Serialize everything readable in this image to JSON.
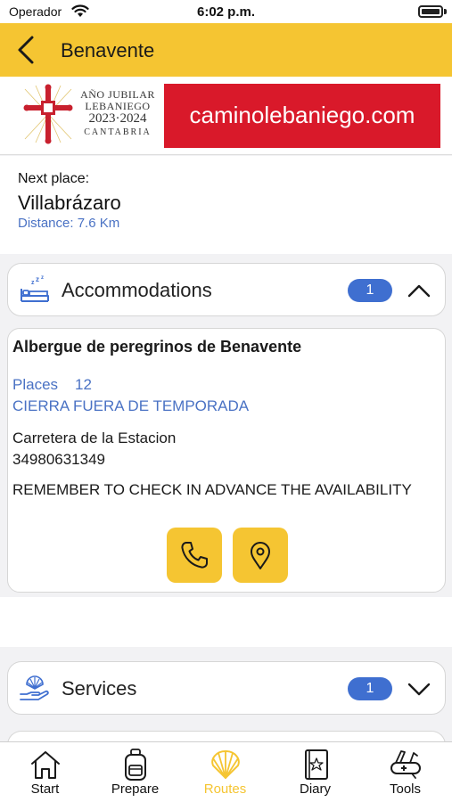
{
  "status_bar": {
    "carrier": "Operador",
    "time": "6:02 p.m."
  },
  "nav": {
    "title": "Benavente",
    "back_icon": "chevron-left-icon"
  },
  "banner": {
    "logo_line1": "AÑO JUBILAR",
    "logo_line2": "LEBANIEGO",
    "logo_years": "2023·2024",
    "logo_region": "CANTABRIA",
    "site_text": "caminolebaniego.com",
    "red_color": "#d9192a"
  },
  "next_place": {
    "label": "Next place:",
    "name": "Villabrázaro",
    "distance": "Distance: 7.6 Km"
  },
  "accommodations": {
    "title": "Accommodations",
    "count": "1",
    "icon": "bed-icon",
    "expanded": true,
    "items": [
      {
        "name": "Albergue de peregrinos de Benavente",
        "places_label": "Places",
        "places_value": "12",
        "season": "CIERRA FUERA DE TEMPORADA",
        "address": "Carretera de la Estacion",
        "phone": "34980631349",
        "note": "REMEMBER TO CHECK IN ADVANCE THE AVAILABILITY"
      }
    ]
  },
  "services": {
    "title": "Services",
    "count": "1",
    "icon": "hand-shell-icon",
    "expanded": false
  },
  "tabbar": {
    "items": [
      {
        "label": "Start",
        "icon": "house-icon"
      },
      {
        "label": "Prepare",
        "icon": "backpack-icon"
      },
      {
        "label": "Routes",
        "icon": "scallop-shell-icon"
      },
      {
        "label": "Diary",
        "icon": "notebook-icon"
      },
      {
        "label": "Tools",
        "icon": "swiss-knife-icon"
      }
    ],
    "active_index": 2
  },
  "colors": {
    "accent_yellow": "#f5c532",
    "link_blue": "#4a72c4",
    "badge_blue": "#3f6fd0"
  }
}
